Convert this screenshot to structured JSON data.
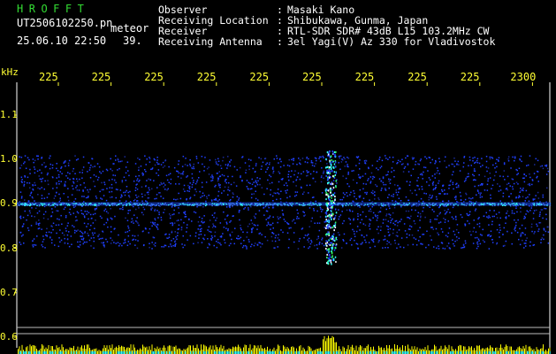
{
  "header": {
    "logo": "HROFFT",
    "filename": "UT2506102250.pn",
    "type": "meteor",
    "datetime": "25.06.10 22:50",
    "count": "39."
  },
  "info": [
    {
      "label": "Observer",
      "value": "Masaki Kano"
    },
    {
      "label": "Receiving Location",
      "value": "Shibukawa, Gunma, Japan"
    },
    {
      "label": "Receiver",
      "value": "RTL-SDR SDR# 43dB L15 103.2MHz CW"
    },
    {
      "label": "Receiving Antenna",
      "value": "3el Yagi(V) Az 330 for Vladivostok"
    }
  ],
  "info_sep": ":",
  "colors": {
    "text_white": "#ffffff",
    "text_green": "#33dd33",
    "axis_yellow": "#ffff33",
    "background": "#000000",
    "signal_blue": "#2040ff",
    "signal_cyan": "#33ffff",
    "bar_yellow": "#ffff00"
  },
  "chart_data": {
    "type": "heatmap",
    "ylabel": "kHz",
    "y_ticks": [
      "1.1",
      "1.0",
      "0.9",
      "0.8",
      "0.7",
      "0.6"
    ],
    "x_ticks": [
      "225",
      "225",
      "225",
      "225",
      "225",
      "225",
      "225",
      "225",
      "225",
      "2300"
    ],
    "ylim": [
      0.6,
      1.1
    ],
    "band_range_khz": [
      0.8,
      1.0
    ],
    "carrier_khz": 0.9,
    "meteor_event_x_index": 5.35
  }
}
